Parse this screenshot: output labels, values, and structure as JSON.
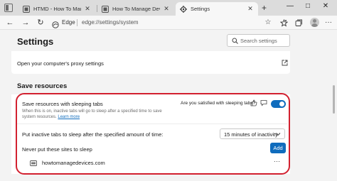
{
  "browser": {
    "tabs": [
      {
        "title": "HTMD - How To Manage Device",
        "icon": "htmd-favicon-icon",
        "active": false
      },
      {
        "title": "How To Manage Devices Comm",
        "icon": "htmd-favicon-icon",
        "active": false
      },
      {
        "title": "Settings",
        "icon": "gear-icon",
        "active": true
      }
    ],
    "new_tab_glyph": "+",
    "brand": "Edge",
    "url": "edge://settings/system",
    "window_controls": [
      "—",
      "□",
      "✕"
    ]
  },
  "settings": {
    "page_title": "Settings",
    "search_placeholder": "Search settings",
    "proxy_label": "Open your computer's proxy settings",
    "section_title": "Save resources",
    "sleeping_tabs": {
      "title": "Save resources with sleeping tabs",
      "description": "When this is on, inactive tabs will go to sleep after a specified time to save system resources.",
      "learn_more": "Learn more",
      "feedback_prompt": "Are you satisfied with sleeping tabs?",
      "enabled": true
    },
    "inactive_timer": {
      "label": "Put inactive tabs to sleep after the specified amount of time:",
      "selected": "15 minutes of inactivity"
    },
    "never_sleep": {
      "label": "Never put these sites to sleep",
      "add_label": "Add",
      "sites": [
        {
          "name": "howtomanagedevices.com",
          "more": "···"
        }
      ]
    }
  },
  "colors": {
    "accent": "#0f6cbd",
    "highlight": "#d2202f"
  }
}
